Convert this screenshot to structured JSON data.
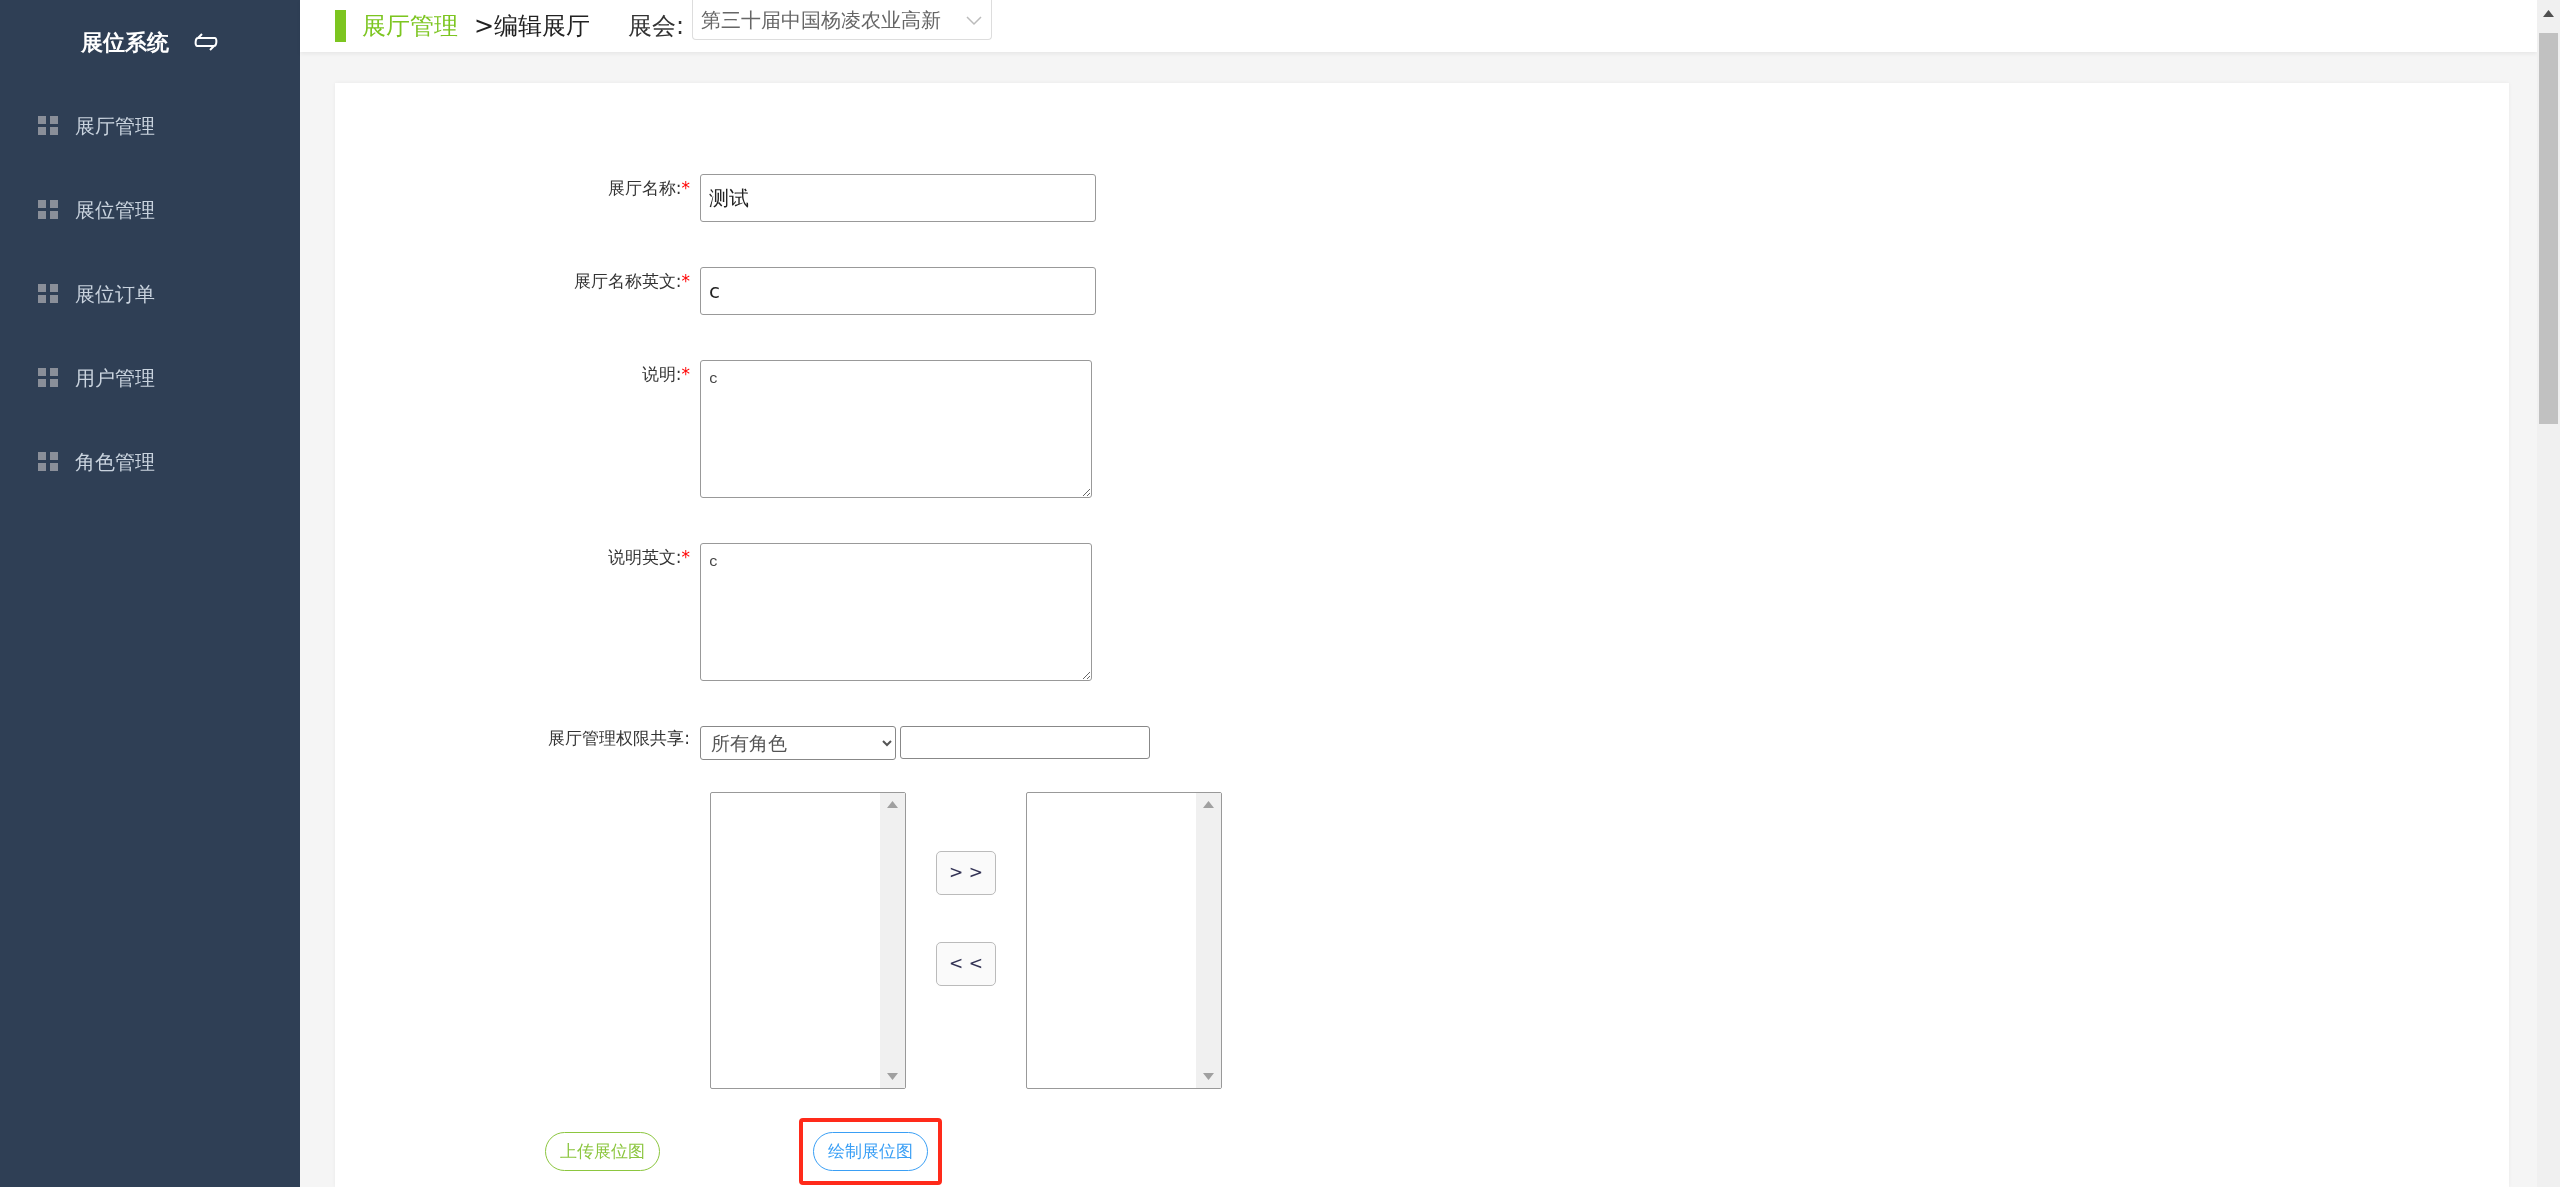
{
  "sidebar": {
    "title": "展位系统",
    "items": [
      {
        "label": "展厅管理",
        "selected": false
      },
      {
        "label": "展位管理",
        "selected": false
      },
      {
        "label": "展位订单",
        "selected": false
      },
      {
        "label": "用户管理",
        "selected": false
      },
      {
        "label": "角色管理",
        "selected": false
      }
    ]
  },
  "header": {
    "section": "展厅管理",
    "page": ">编辑展厅",
    "exhibition_label": "展会:",
    "exhibition_value": "第三十届中国杨凌农业高新"
  },
  "form": {
    "fields": [
      {
        "kind": "input",
        "label": "展厅名称:",
        "mark": "*",
        "value": "测试"
      },
      {
        "kind": "input",
        "label": "展厅名称英文:",
        "mark": "*",
        "value": "c"
      },
      {
        "kind": "textarea",
        "label": "说明:",
        "mark": "*",
        "value": "c"
      },
      {
        "kind": "textarea",
        "label": "说明英文:",
        "mark": "*",
        "value": "c"
      }
    ],
    "sharing": {
      "label": "展厅管理权限共享:",
      "role_select": "所有角色",
      "transfer_buttons": [
        "> >",
        "< <"
      ]
    },
    "buttons": [
      {
        "label": "上传展位图",
        "color": "#8cc63f",
        "highlighted": false
      },
      {
        "label": "绘制展位图",
        "color": "#3a9ff5",
        "highlighted": true
      }
    ]
  }
}
